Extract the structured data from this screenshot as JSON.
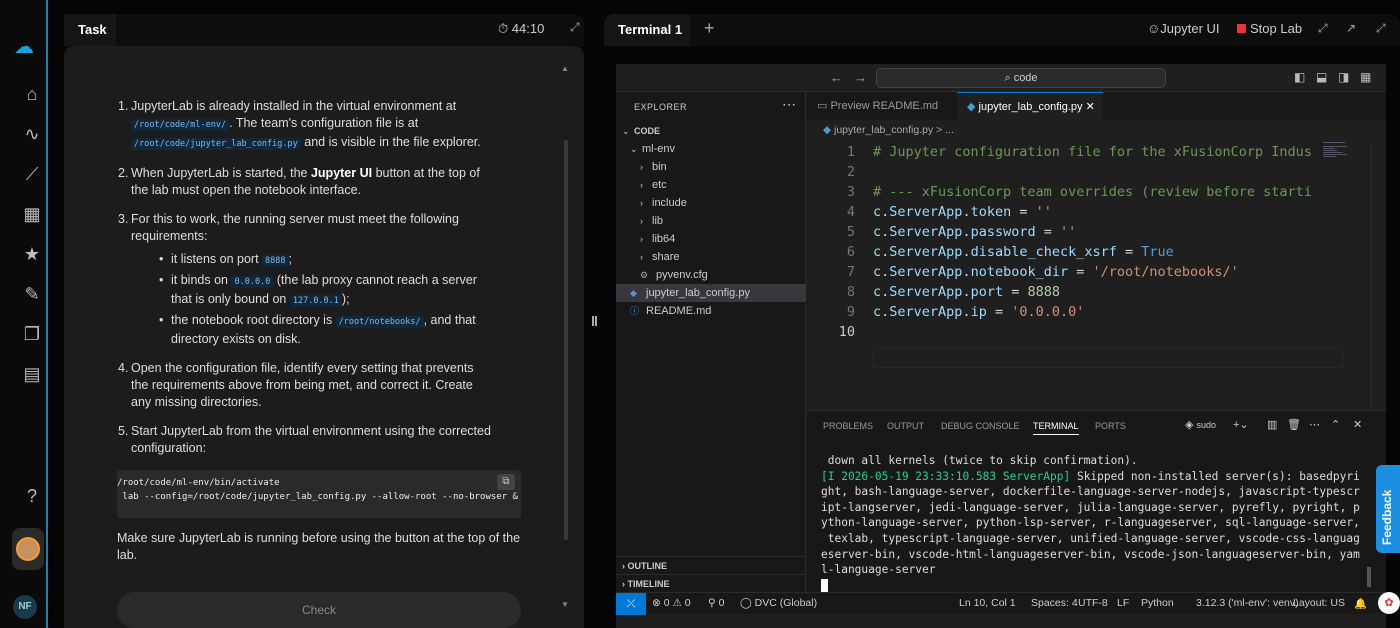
{
  "task": {
    "tab": "Task",
    "timer": "44:10",
    "items": [
      {
        "num": "1.",
        "pre": "JupyterLab is already installed in the virtual environment at ",
        "code1": "/root/code/ml-env/",
        "mid": ". The team's configuration file is at ",
        "code2": "/root/code/jupyter_lab_config.py",
        "post": " and is visible in the file explorer."
      },
      {
        "num": "2.",
        "pre": "When JupyterLab is started, the ",
        "bold": "Jupyter UI",
        "post": " button at the top of the lab must open the notebook interface."
      },
      {
        "num": "3.",
        "text": "For this to work, the running server must meet the following requirements:",
        "bullets": [
          {
            "pre": "it listens on port ",
            "code": "8888",
            "post": ";"
          },
          {
            "pre": "it binds on ",
            "code": "0.0.0.0",
            "post": " (the lab proxy cannot reach a server that is only bound on ",
            "code2": "127.0.0.1",
            "post2": ");"
          },
          {
            "pre": "the notebook root directory is ",
            "code": "/root/notebooks/",
            "post": ", and that directory exists on disk."
          }
        ]
      },
      {
        "num": "4.",
        "text": "Open the configuration file, identify every setting that prevents the requirements above from being met, and correct it. Create any missing directories."
      },
      {
        "num": "5.",
        "text": "Start JupyterLab from the virtual environment using the corrected configuration:"
      }
    ],
    "code_lines": [
      "/root/code/ml-env/bin/activate",
      " lab --config=/root/code/jupyter_lab_config.py --allow-root --no-browser &"
    ],
    "final": "Make sure JupyterLab is running before using the button at the top of the lab.",
    "check": "Check"
  },
  "right": {
    "tab": "Terminal 1",
    "jupyter": "Jupyter UI",
    "stop": "Stop Lab"
  },
  "vscode": {
    "search": "code",
    "explorer_title": "EXPLORER",
    "tree": [
      {
        "label": "CODE",
        "level": 0,
        "chev": "v",
        "bold": true
      },
      {
        "label": "ml-env",
        "level": 1,
        "chev": "v"
      },
      {
        "label": "bin",
        "level": 2,
        "chev": ">"
      },
      {
        "label": "etc",
        "level": 2,
        "chev": ">"
      },
      {
        "label": "include",
        "level": 2,
        "chev": ">"
      },
      {
        "label": "lib",
        "level": 2,
        "chev": ">"
      },
      {
        "label": "lib64",
        "level": 2,
        "chev": ">"
      },
      {
        "label": "share",
        "level": 2,
        "chev": ">"
      },
      {
        "label": "pyvenv.cfg",
        "level": 2,
        "chev": ""
      },
      {
        "label": "jupyter_lab_config.py",
        "level": 1,
        "chev": "",
        "sel": true
      },
      {
        "label": "README.md",
        "level": 1,
        "chev": ""
      }
    ],
    "outline": "OUTLINE",
    "timeline": "TIMELINE",
    "tabs": [
      "Preview README.md",
      "jupyter_lab_config.py"
    ],
    "breadcrumb": "jupyter_lab_config.py > ...",
    "code": [
      {
        "n": "1",
        "t": "# Jupyter configuration file for the xFusionCorp Indus"
      },
      {
        "n": "2",
        "t": ""
      },
      {
        "n": "3",
        "t": "# --- xFusionCorp team overrides (review before starti"
      },
      {
        "n": "4",
        "t": "c.ServerApp.token = ''"
      },
      {
        "n": "5",
        "t": "c.ServerApp.password = ''"
      },
      {
        "n": "6",
        "t": "c.ServerApp.disable_check_xsrf = True"
      },
      {
        "n": "7",
        "t": "c.ServerApp.notebook_dir = '/root/notebooks/'"
      },
      {
        "n": "8",
        "t": "c.ServerApp.port = 8888"
      },
      {
        "n": "9",
        "t": "c.ServerApp.ip = '0.0.0.0'"
      },
      {
        "n": "10",
        "t": ""
      }
    ],
    "panel_tabs": [
      "PROBLEMS",
      "OUTPUT",
      "DEBUG CONSOLE",
      "TERMINAL",
      "PORTS"
    ],
    "sudo": "sudo",
    "terminal": [
      " down all kernels (twice to skip confirmation).",
      "[I 2026-05-19 23:33:10.583 ServerApp] Skipped non-installed server(s): basedpyri",
      "ght, bash-language-server, dockerfile-language-server-nodejs, javascript-typescr",
      "ipt-langserver, jedi-language-server, julia-language-server, pyrefly, pyright, p",
      "ython-language-server, python-lsp-server, r-languageserver, sql-language-server,",
      " texlab, typescript-language-server, unified-language-server, vscode-css-languag",
      "eserver-bin, vscode-html-languageserver-bin, vscode-json-languageserver-bin, yam",
      "l-language-server"
    ],
    "status": {
      "problems": "⊗ 0 ⚠ 0",
      "ports": "⚲ 0",
      "dvc": "◯ DVC (Global)",
      "pos": "Ln 10, Col 1",
      "spaces": "Spaces: 4",
      "enc": "UTF-8",
      "eol": "LF",
      "lang": "Python",
      "py": "3.12.3 ('ml-env': venv)",
      "layout": "Layout: US"
    }
  },
  "feedback": "Feedback",
  "avatar_initials": "NF"
}
